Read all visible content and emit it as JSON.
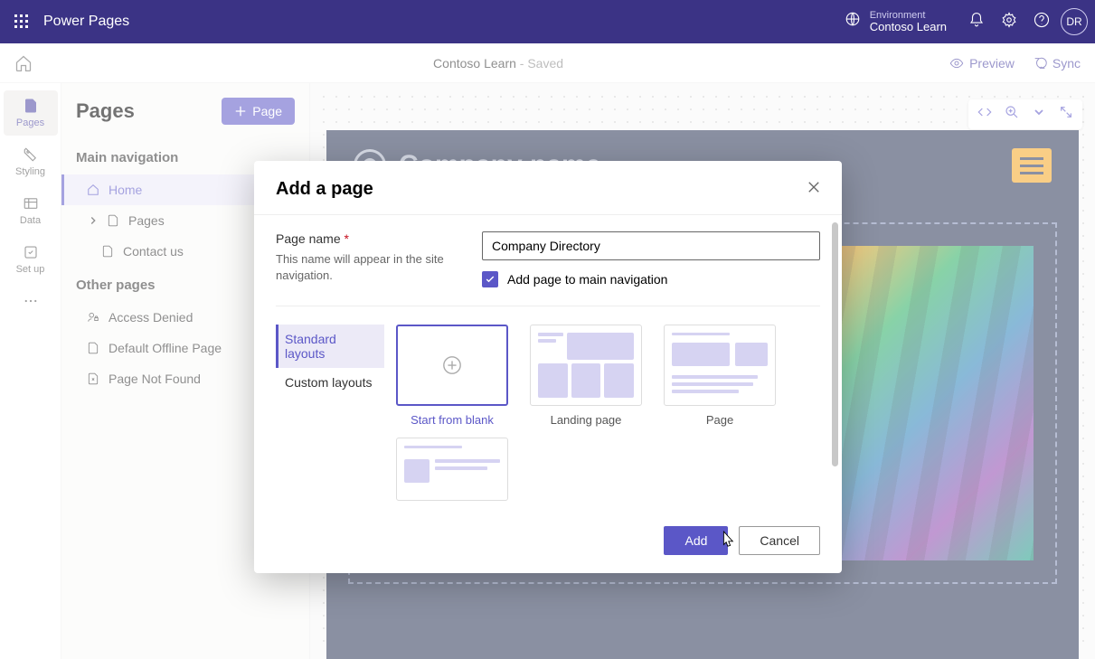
{
  "topbar": {
    "app_name": "Power Pages",
    "env_label": "Environment",
    "env_name": "Contoso Learn",
    "avatar_initials": "DR"
  },
  "cmdbar": {
    "site_name": "Contoso Learn",
    "status": " - Saved",
    "preview": "Preview",
    "sync": "Sync"
  },
  "rail": {
    "pages": "Pages",
    "styling": "Styling",
    "data": "Data",
    "setup": "Set up"
  },
  "sidepanel": {
    "title": "Pages",
    "add_button": "Page",
    "section_main": "Main navigation",
    "item_home": "Home",
    "item_pages": "Pages",
    "item_contact": "Contact us",
    "section_other": "Other pages",
    "item_access_denied": "Access Denied",
    "item_offline": "Default Offline Page",
    "item_notfound": "Page Not Found"
  },
  "site": {
    "company_name": "Company name"
  },
  "modal": {
    "title": "Add a page",
    "page_name_label": "Page name",
    "page_name_hint": "This name will appear in the site navigation.",
    "page_name_value": "Company Directory",
    "checkbox_label": "Add page to main navigation",
    "tab_standard": "Standard layouts",
    "tab_custom": "Custom layouts",
    "layout_blank": "Start from blank",
    "layout_landing": "Landing page",
    "layout_page": "Page",
    "add_button": "Add",
    "cancel_button": "Cancel"
  }
}
